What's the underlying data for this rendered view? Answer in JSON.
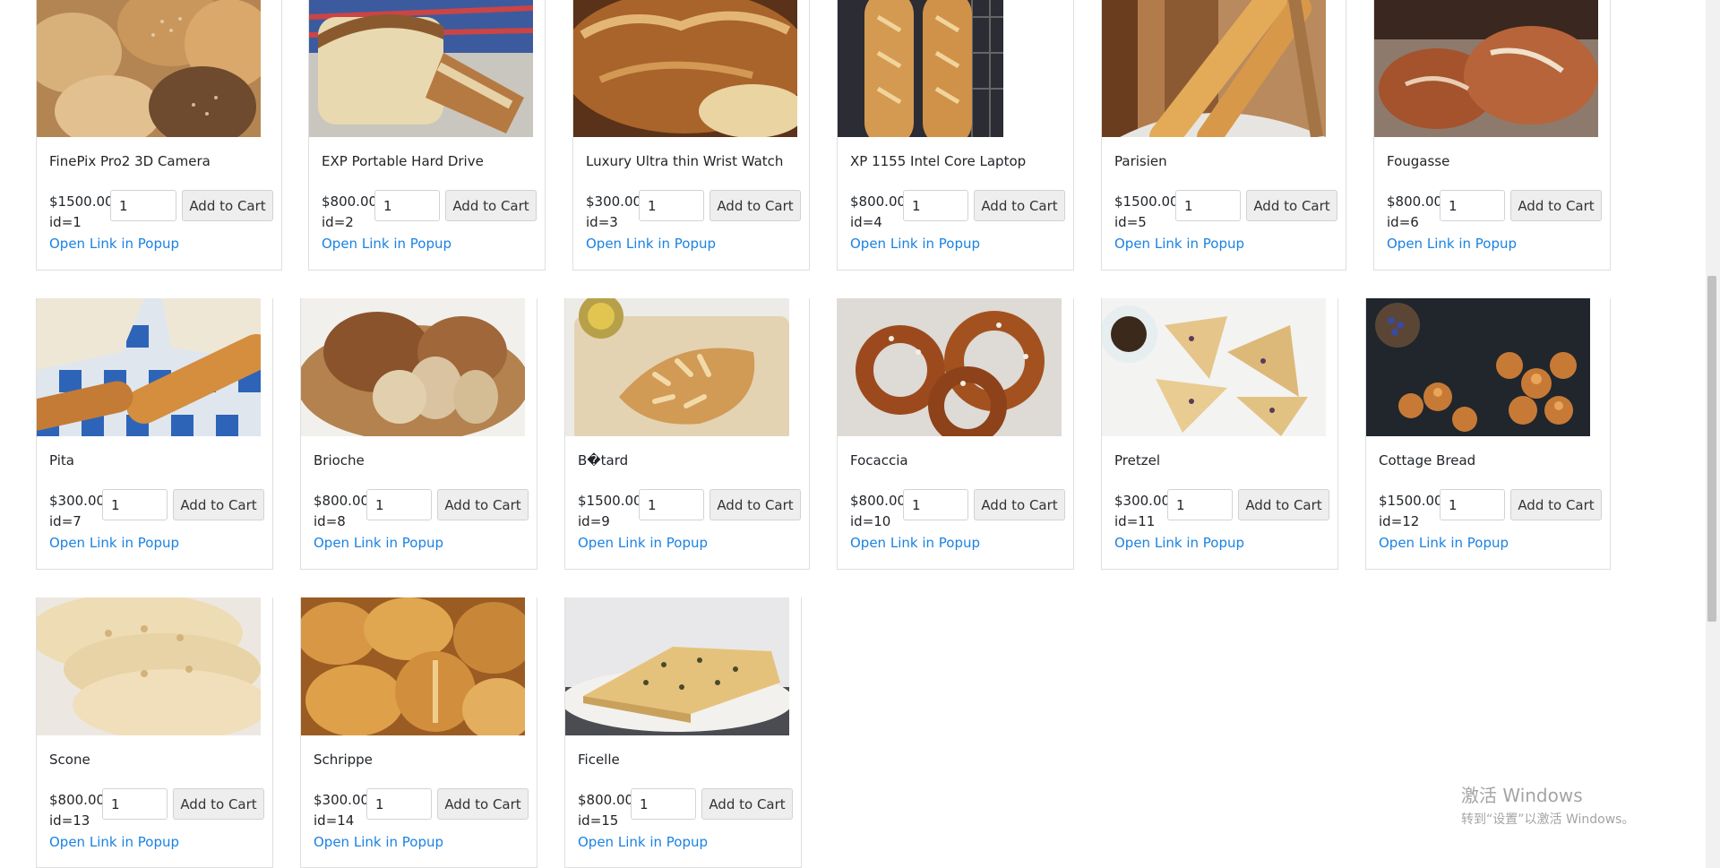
{
  "products": [
    {
      "name": "FinePix Pro2 3D Camera",
      "price": "$1500.00",
      "qty": "1",
      "id": "id=1",
      "button": "Add to Cart",
      "link": "Open Link in Popup",
      "image": "bread-rolls"
    },
    {
      "name": "EXP Portable Hard Drive",
      "price": "$800.00",
      "qty": "1",
      "id": "id=2",
      "button": "Add to Cart",
      "link": "Open Link in Popup",
      "image": "sliced-loaf"
    },
    {
      "name": "Luxury Ultra thin Wrist Watch",
      "price": "$300.00",
      "qty": "1",
      "id": "id=3",
      "button": "Add to Cart",
      "link": "Open Link in Popup",
      "image": "rustic-crust"
    },
    {
      "name": "XP 1155 Intel Core Laptop",
      "price": "$800.00",
      "qty": "1",
      "id": "id=4",
      "button": "Add to Cart",
      "link": "Open Link in Popup",
      "image": "baguettes"
    },
    {
      "name": "Parisien",
      "price": "$1500.00",
      "qty": "1",
      "id": "id=5",
      "button": "Add to Cart",
      "link": "Open Link in Popup",
      "image": "baguettes-basket"
    },
    {
      "name": "Fougasse",
      "price": "$800.00",
      "qty": "1",
      "id": "id=6",
      "button": "Add to Cart",
      "link": "Open Link in Popup",
      "image": "round-loaves"
    },
    {
      "name": "Pita",
      "price": "$300.00",
      "qty": "1",
      "id": "id=7",
      "button": "Add to Cart",
      "link": "Open Link in Popup",
      "image": "parisien-newspaper"
    },
    {
      "name": "Brioche",
      "price": "$800.00",
      "qty": "1",
      "id": "id=8",
      "button": "Add to Cart",
      "link": "Open Link in Popup",
      "image": "brioche-board"
    },
    {
      "name": "B�tard",
      "price": "$1500.00",
      "qty": "1",
      "id": "id=9",
      "button": "Add to Cart",
      "link": "Open Link in Popup",
      "image": "fougasse-tray"
    },
    {
      "name": "Focaccia",
      "price": "$800.00",
      "qty": "1",
      "id": "id=10",
      "button": "Add to Cart",
      "link": "Open Link in Popup",
      "image": "pretzels"
    },
    {
      "name": "Pretzel",
      "price": "$300.00",
      "qty": "1",
      "id": "id=11",
      "button": "Add to Cart",
      "link": "Open Link in Popup",
      "image": "scones"
    },
    {
      "name": "Cottage Bread",
      "price": "$1500.00",
      "qty": "1",
      "id": "id=12",
      "button": "Add to Cart",
      "link": "Open Link in Popup",
      "image": "dark-buns"
    },
    {
      "name": "Scone",
      "price": "$800.00",
      "qty": "1",
      "id": "id=13",
      "button": "Add to Cart",
      "link": "Open Link in Popup",
      "image": "pita-stack"
    },
    {
      "name": "Schrippe",
      "price": "$300.00",
      "qty": "1",
      "id": "id=14",
      "button": "Add to Cart",
      "link": "Open Link in Popup",
      "image": "rolls-pile"
    },
    {
      "name": "Ficelle",
      "price": "$800.00",
      "qty": "1",
      "id": "id=15",
      "button": "Add to Cart",
      "link": "Open Link in Popup",
      "image": "focaccia-plate"
    }
  ],
  "watermark": {
    "title": "激活 Windows",
    "subtitle": "转到“设置”以激活 Windows。"
  },
  "colors": {
    "link": "#1a82e2",
    "card_border": "#dfdfdf",
    "button_bg": "#eeeeee"
  }
}
